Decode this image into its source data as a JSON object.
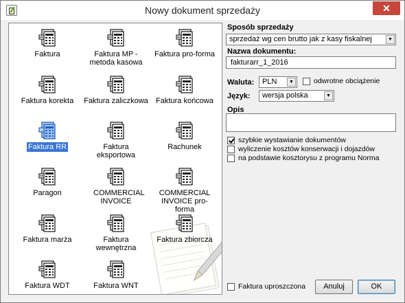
{
  "window": {
    "title": "Nowy dokument sprzedaży",
    "close_glyph": "✕"
  },
  "documents": [
    {
      "label": "Faktura"
    },
    {
      "label": "Faktura MP - metoda kasowa"
    },
    {
      "label": "Faktura pro-forma"
    },
    {
      "label": "Faktura korekta"
    },
    {
      "label": "Faktura zaliczkowa"
    },
    {
      "label": "Faktura końcowa"
    },
    {
      "label": "Faktura RR",
      "selected": true
    },
    {
      "label": "Faktura eksportowa"
    },
    {
      "label": "Rachunek"
    },
    {
      "label": "Paragon"
    },
    {
      "label": "COMMERCIAL INVOICE"
    },
    {
      "label": "COMMERCIAL INVOICE pro-forma"
    },
    {
      "label": "Faktura marża"
    },
    {
      "label": "Faktura wewnętrzna"
    },
    {
      "label": "Faktura zbiorcza"
    },
    {
      "label": "Faktura WDT"
    },
    {
      "label": "Faktura WNT"
    }
  ],
  "form": {
    "sposob_label": "Sposób sprzedaży",
    "sposob_value": "sprzedaż wg cen brutto jak z kasy fiskalnej",
    "nazwa_label": "Nazwa dokumentu:",
    "nazwa_value": "fakturarr_1_2016",
    "waluta_label": "Waluta:",
    "waluta_value": "PLN",
    "odwrotne_label": "odwrotne obciążenie",
    "odwrotne_checked": false,
    "jezyk_label": "Język:",
    "jezyk_value": "wersja polska",
    "opis_label": "Opis",
    "opis_value": "",
    "options": [
      {
        "label": "szybkie wystawianie dokumentów",
        "checked": true
      },
      {
        "label": "wyliczenie kosztów konserwacji i dojazdów",
        "checked": false
      },
      {
        "label": "na podstawie kosztorysu z programu Norma",
        "checked": false
      }
    ],
    "uproszczona_label": "Faktura uproszczona",
    "uproszczona_checked": false
  },
  "buttons": {
    "cancel": "Anuluj",
    "ok": "OK"
  },
  "colors": {
    "selection": "#3a75d6",
    "close": "#c7463a"
  },
  "icons": {
    "document": "document-calculator-icon",
    "selected_document": "document-calculator-icon-selected"
  }
}
